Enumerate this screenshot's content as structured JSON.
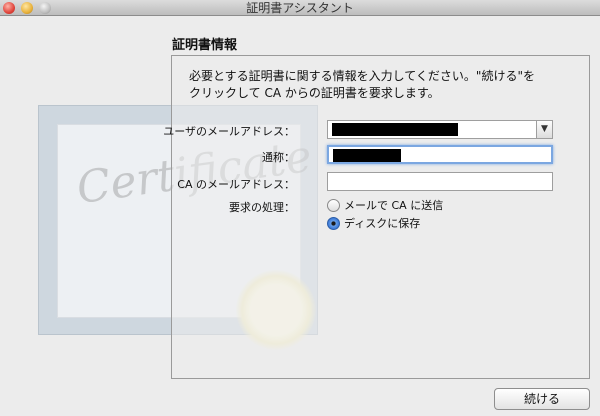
{
  "window": {
    "title": "証明書アシスタント"
  },
  "background": {
    "certificate_word": "Certificate"
  },
  "section": {
    "title": "証明書情報"
  },
  "intro": {
    "line1": "必要とする証明書に関する情報を入力してください。\"続ける\"を",
    "line2": "クリックして CA からの証明書を要求します。"
  },
  "form": {
    "email_label": "ユーザのメールアドレス：",
    "email_value": "",
    "name_label": "通称：",
    "name_value": "",
    "ca_email_label": "CA のメールアドレス：",
    "ca_email_value": "",
    "request_label": "要求の処理：",
    "options": [
      {
        "label": "メールで CA に送信",
        "selected": false
      },
      {
        "label": "ディスクに保存",
        "selected": true
      }
    ]
  },
  "buttons": {
    "continue_label": "続ける"
  }
}
